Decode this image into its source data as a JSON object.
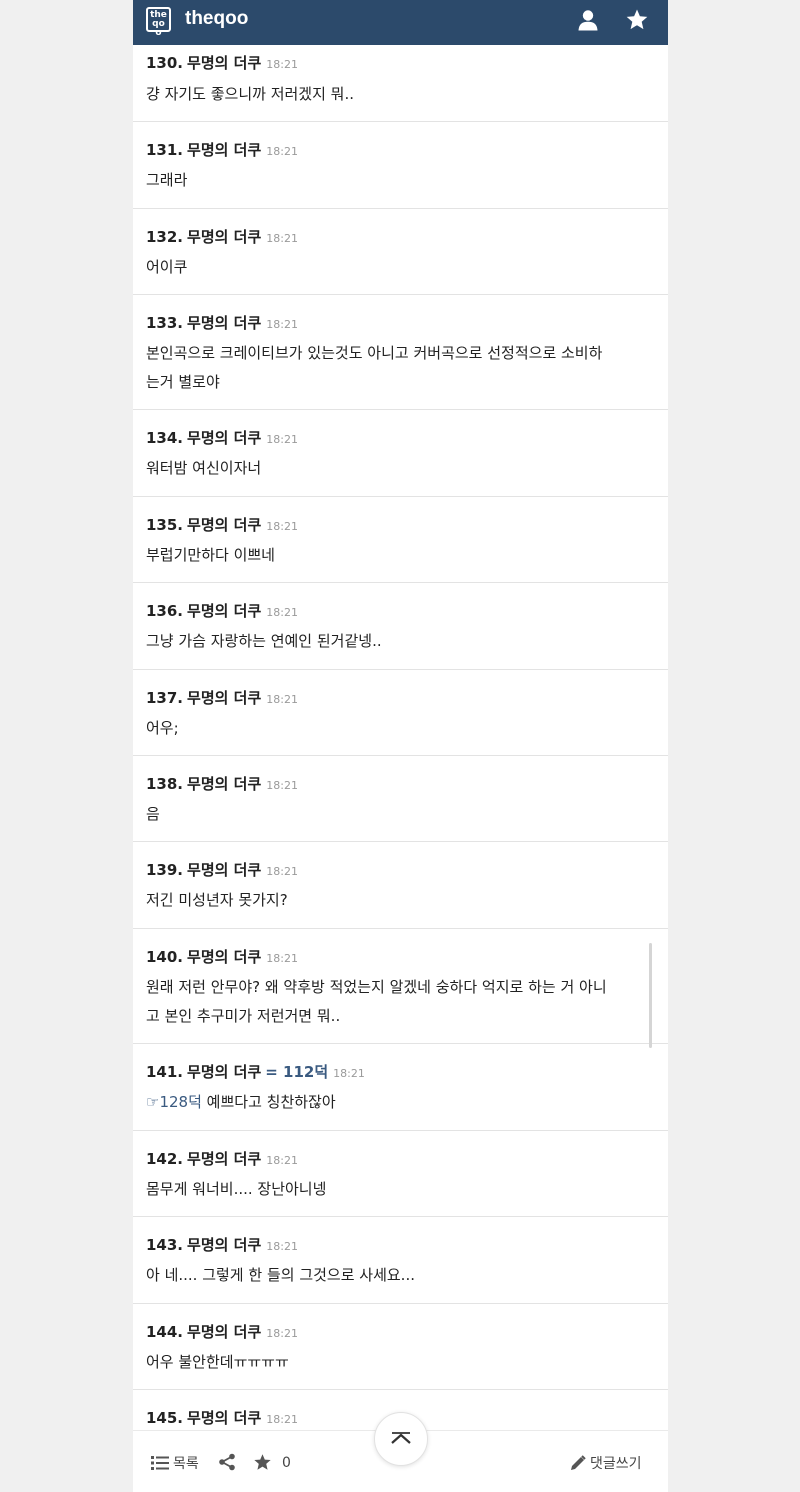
{
  "header": {
    "logo_text": "the qoo",
    "site_name": "theqoo",
    "icons": [
      "user-icon",
      "star-icon"
    ]
  },
  "comments": [
    {
      "number": "130.",
      "author": "무명의 더쿠",
      "time": "18:21",
      "body": "걍 자기도 좋으니까 저러겠지 뭐.."
    },
    {
      "number": "131.",
      "author": "무명의 더쿠",
      "time": "18:21",
      "body": "그래라"
    },
    {
      "number": "132.",
      "author": "무명의 더쿠",
      "time": "18:21",
      "body": "어이쿠"
    },
    {
      "number": "133.",
      "author": "무명의 더쿠",
      "time": "18:21",
      "body_line1": "본인곡으로 크레이티브가 있는것도 아니고 커버곡으로 선정적으로 소비하",
      "body_line2": "는거 별로야"
    },
    {
      "number": "134.",
      "author": "무명의 더쿠",
      "time": "18:21",
      "body": "워터밤 여신이자너"
    },
    {
      "number": "135.",
      "author": "무명의 더쿠",
      "time": "18:21",
      "body": "부럽기만하다 이쁘네"
    },
    {
      "number": "136.",
      "author": "무명의 더쿠",
      "time": "18:21",
      "body": "그냥 가슴 자랑하는 연예인 된거같넹.."
    },
    {
      "number": "137.",
      "author": "무명의 더쿠",
      "time": "18:21",
      "body": "어우;"
    },
    {
      "number": "138.",
      "author": "무명의 더쿠",
      "time": "18:21",
      "body": "음"
    },
    {
      "number": "139.",
      "author": "무명의 더쿠",
      "time": "18:21",
      "body": "저긴 미성년자 못가지?"
    },
    {
      "number": "140.",
      "author": "무명의 더쿠",
      "time": "18:21",
      "body_line1": "원래 저런 안무야? 왜 약후방 적었는지 알겠네 숭하다 억지로 하는 거 아니",
      "body_line2": "고 본인 추구미가 저런거면 뭐.."
    },
    {
      "number": "141.",
      "author": "무명의 더쿠",
      "reply_to": "= 112덕",
      "time": "18:21",
      "quote": "☞128덕",
      "body": "예쁘다고 칭찬하잖아"
    },
    {
      "number": "142.",
      "author": "무명의 더쿠",
      "time": "18:21",
      "body": "몸무게 워너비.... 장난아니넹"
    },
    {
      "number": "143.",
      "author": "무명의 더쿠",
      "time": "18:21",
      "body": "아 네.... 그렇게 한 들의 그것으로 사세요..."
    },
    {
      "number": "144.",
      "author": "무명의 더쿠",
      "time": "18:21",
      "body": "어우 불안한데ㅠㅠㅠㅠ"
    },
    {
      "number": "145.",
      "author": "무명의 더쿠",
      "time": "18:21"
    }
  ],
  "bottom_bar": {
    "list_label": "목록",
    "star_count": "0",
    "write_label": "댓글쓰기"
  }
}
